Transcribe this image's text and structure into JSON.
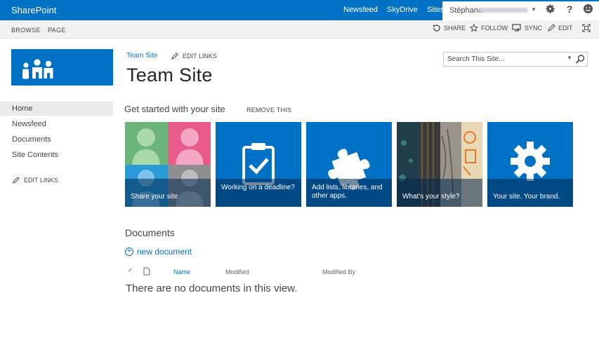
{
  "suite": {
    "brand": "SharePoint",
    "links": [
      "Newsfeed",
      "SkyDrive",
      "Sites"
    ],
    "user_name": "Stéphane"
  },
  "ribbon": {
    "tabs": [
      "BROWSE",
      "PAGE"
    ],
    "actions": {
      "share": "SHARE",
      "follow": "FOLLOW",
      "sync": "SYNC",
      "edit": "EDIT"
    }
  },
  "nav": {
    "items": [
      "Home",
      "Newsfeed",
      "Documents",
      "Site Contents"
    ],
    "edit_links": "EDIT LINKS"
  },
  "header": {
    "breadcrumb": "Team Site",
    "edit_links": "EDIT LINKS",
    "title": "Team Site"
  },
  "search": {
    "placeholder": "Search This Site..."
  },
  "get_started": {
    "title": "Get started with your site",
    "remove": "REMOVE THIS",
    "tiles": [
      {
        "caption": "Share your site"
      },
      {
        "caption": "Working on a deadline?"
      },
      {
        "caption": "Add lists, libraries, and other apps."
      },
      {
        "caption": "What's your style?"
      },
      {
        "caption": "Your site. Your brand."
      }
    ]
  },
  "documents": {
    "title": "Documents",
    "new_document": "new document",
    "columns": [
      "Name",
      "Modified",
      "Modified By"
    ],
    "empty_message": "There are no documents in this view."
  },
  "colors": {
    "brand_blue": "#0072c6",
    "tile_green": "#6bb57b",
    "tile_pink": "#e85b8b",
    "tile_teal": "#2b9ad6"
  }
}
